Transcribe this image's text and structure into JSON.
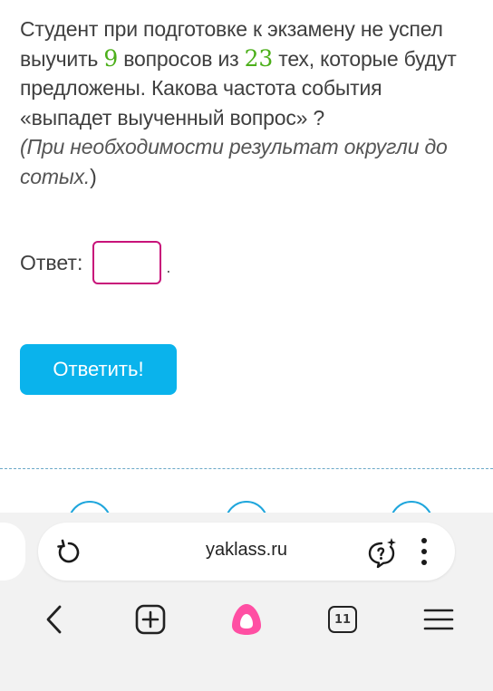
{
  "question": {
    "part1": "Студент при подготовке к экзамену не успел выучить ",
    "num1": "9",
    "part2": " вопросов из ",
    "num2": "23",
    "part3": " тех, которые будут предложены. Какова частота события «выпадет выученный вопрос» ?",
    "hint_open": "(",
    "hint": "При необходимости результат округли до сотых.",
    "hint_close": ")"
  },
  "answer": {
    "label": "Ответ:",
    "value": "",
    "trailing": "."
  },
  "submit_label": "Ответить!",
  "browser": {
    "url": "yaklass.ru",
    "tab_count": "11"
  },
  "colors": {
    "accent_button": "#0ab3ec",
    "input_border": "#c8137a",
    "number_green": "#4caf1a",
    "alice_pink": "#ff4fa3"
  },
  "icons": {
    "reload": "reload-icon",
    "chat": "chat-question-sparkle-icon",
    "menu": "vertical-dots-icon",
    "back": "chevron-left-icon",
    "new_tab": "plus-square-icon",
    "assistant": "alice-icon",
    "tabs": "tabs-counter-icon",
    "hamburger": "hamburger-menu-icon"
  }
}
